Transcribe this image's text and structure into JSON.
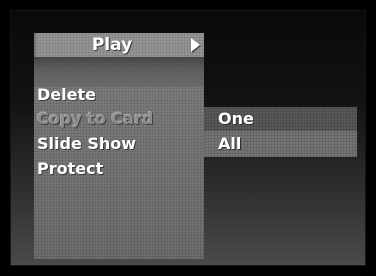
{
  "menu": {
    "title": "Play",
    "items": [
      {
        "label": "Delete",
        "state": "enabled"
      },
      {
        "label": "Copy to Card",
        "state": "disabled"
      },
      {
        "label": "Slide Show",
        "state": "enabled"
      },
      {
        "label": "Protect",
        "state": "enabled"
      }
    ]
  },
  "submenu": {
    "items": [
      {
        "label": "One",
        "state": "highlighted"
      },
      {
        "label": "All",
        "state": "normal"
      }
    ]
  },
  "colors": {
    "background": "#000000",
    "menu_panel": "#7f7f7f",
    "highlight": "#5c5c5c",
    "text": "#ffffff",
    "disabled_text": "#8e8e8e"
  },
  "icons": {
    "title_arrow": "triangle-right-icon"
  }
}
